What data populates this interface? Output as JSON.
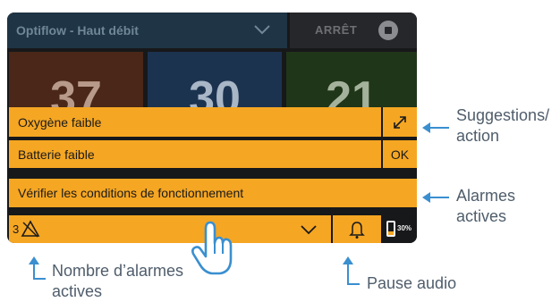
{
  "device": {
    "mode_label": "Optiflow - Haut débit",
    "stop_label": "ARRÊT",
    "tiles": [
      "37",
      "30",
      "21"
    ],
    "alarms": [
      {
        "text": "Oxygène faible",
        "action_icon": "expand-icon"
      },
      {
        "text": "Batterie faible",
        "action_label": "OK"
      },
      {
        "text": "Vérifier les conditions de fonctionnement"
      }
    ],
    "bottom_bar": {
      "alarm_count": "3",
      "alarm_icon": "alarm-triangle-icon",
      "expand_icon": "chevron-down-icon",
      "pause_icon": "bell-icon",
      "battery_label": "30%",
      "battery_level": 0.3
    }
  },
  "callouts": {
    "suggestions": "Suggestions/ action",
    "active_alarms": "Alarmes actives",
    "alarm_count": "Nombre d’alarmes actives",
    "audio_pause": "Pause audio"
  },
  "colors": {
    "alarm": "#f5a623",
    "accent": "#3a8fcf",
    "callout_text": "#4f5d6b"
  }
}
